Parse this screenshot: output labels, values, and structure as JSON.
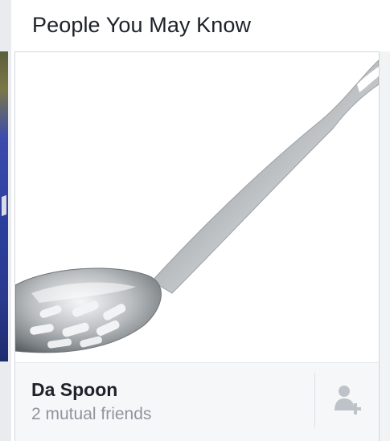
{
  "section": {
    "title": "People You May Know"
  },
  "suggestion": {
    "name": "Da Spoon",
    "mutual_friends": "2 mutual friends",
    "photo_icon": "slotted-spoon-photo",
    "action_icon": "add-friend-icon"
  },
  "colors": {
    "title_text": "#1d2129",
    "secondary_text": "#90949c",
    "footer_bg": "#f6f7f9",
    "icon": "#bec2c9"
  }
}
